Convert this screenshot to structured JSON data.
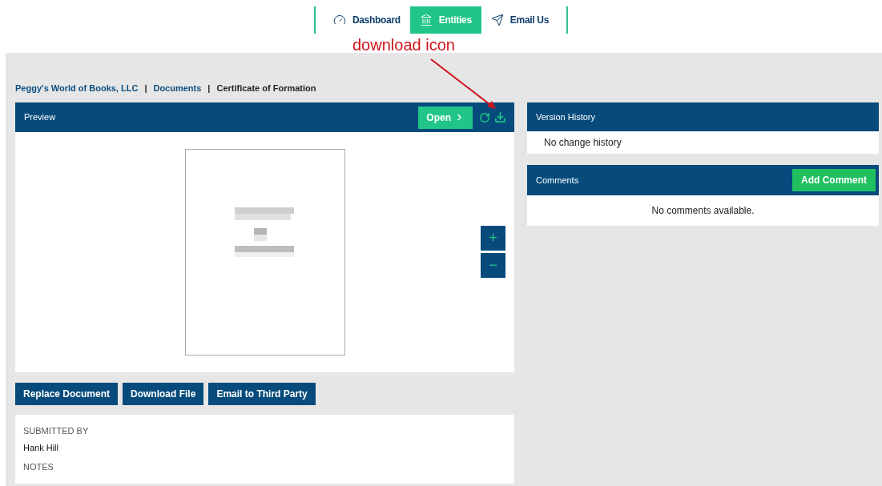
{
  "nav": [
    {
      "label": "Dashboard",
      "kind": "dashboard",
      "selected": false
    },
    {
      "label": "Entities",
      "kind": "entities",
      "selected": true
    },
    {
      "label": "Email Us",
      "kind": "email",
      "selected": false
    }
  ],
  "annotation": {
    "text": "download icon"
  },
  "breadcrumb": [
    {
      "label": "Peggy's World of Books, LLC",
      "link": true
    },
    {
      "label": "Documents",
      "link": true
    },
    {
      "label": "Certificate of Formation",
      "link": false
    }
  ],
  "breadcrumb_separator": "|",
  "preview": {
    "title": "Preview",
    "open_button": "Open",
    "zoom_in": "+",
    "zoom_out": "−"
  },
  "actions": [
    "Replace Document",
    "Download File",
    "Email to Third Party"
  ],
  "details": [
    {
      "label": "SUBMITTED BY",
      "value": "Hank Hill"
    },
    {
      "label": "NOTES"
    }
  ],
  "version_history": {
    "title": "Version History",
    "empty": "No change history"
  },
  "comments": {
    "title": "Comments",
    "add_button": "Add Comment",
    "empty": "No comments available."
  }
}
